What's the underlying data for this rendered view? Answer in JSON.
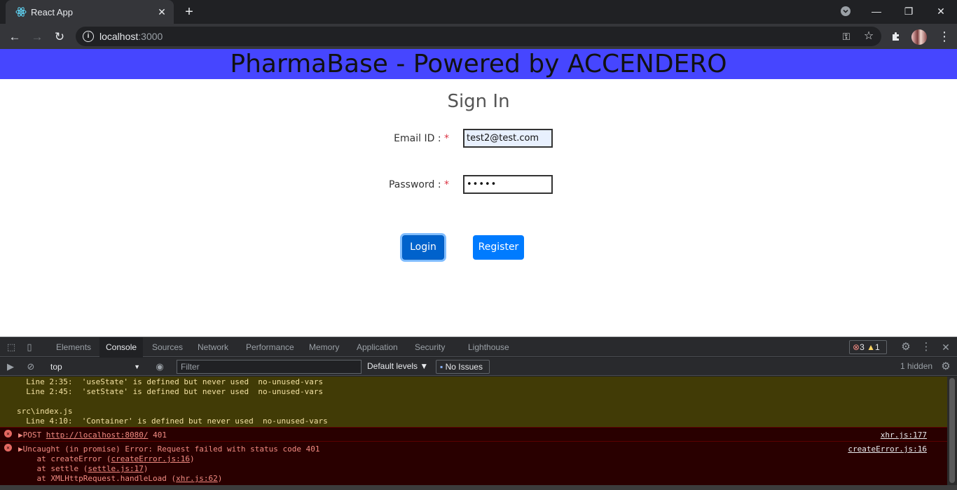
{
  "browser": {
    "tab_title": "React App",
    "url_host": "localhost",
    "url_port": ":3000"
  },
  "page": {
    "banner_title": "PharmaBase - Powered by ACCENDERO",
    "heading": "Sign In",
    "email_label": "Email ID : ",
    "email_value": "test2@test.com",
    "password_label": "Password : ",
    "password_value": "•••••",
    "required_mark": "*",
    "login_label": "Login",
    "register_label": "Register"
  },
  "devtools": {
    "tabs": [
      "Elements",
      "Console",
      "Sources",
      "Network",
      "Performance",
      "Memory",
      "Application",
      "Security",
      "Lighthouse"
    ],
    "active_tab": "Console",
    "error_count": "3",
    "warning_count": "1",
    "context": "top",
    "filter_placeholder": "Filter",
    "levels": "Default levels ▼",
    "no_issues": "No Issues",
    "hidden": "1 hidden",
    "warnings": [
      "  Line 2:35:  'useState' is defined but never used  no-unused-vars",
      "  Line 2:45:  'setState' is defined but never used  no-unused-vars",
      "",
      "src\\index.js",
      "  Line 4:10:  'Container' is defined but never used  no-unused-vars"
    ],
    "error1": {
      "prefix": "▶POST ",
      "url": "http://localhost:8080/",
      "status": " 401",
      "source": "xhr.js:177"
    },
    "error2": {
      "message": "▶Uncaught (in promise) Error: Request failed with status code 401",
      "source": "createError.js:16",
      "stack1_prefix": "    at createError (",
      "stack1_link": "createError.js:16",
      "stack2_prefix": "    at settle (",
      "stack2_link": "settle.js:17",
      "stack3_prefix": "    at XMLHttpRequest.handleLoad (",
      "stack3_link": "xhr.js:62",
      "close_paren": ")"
    }
  },
  "colors": {
    "banner": "#4646ff",
    "primary_button": "#007bff",
    "required": "#dc3545"
  }
}
